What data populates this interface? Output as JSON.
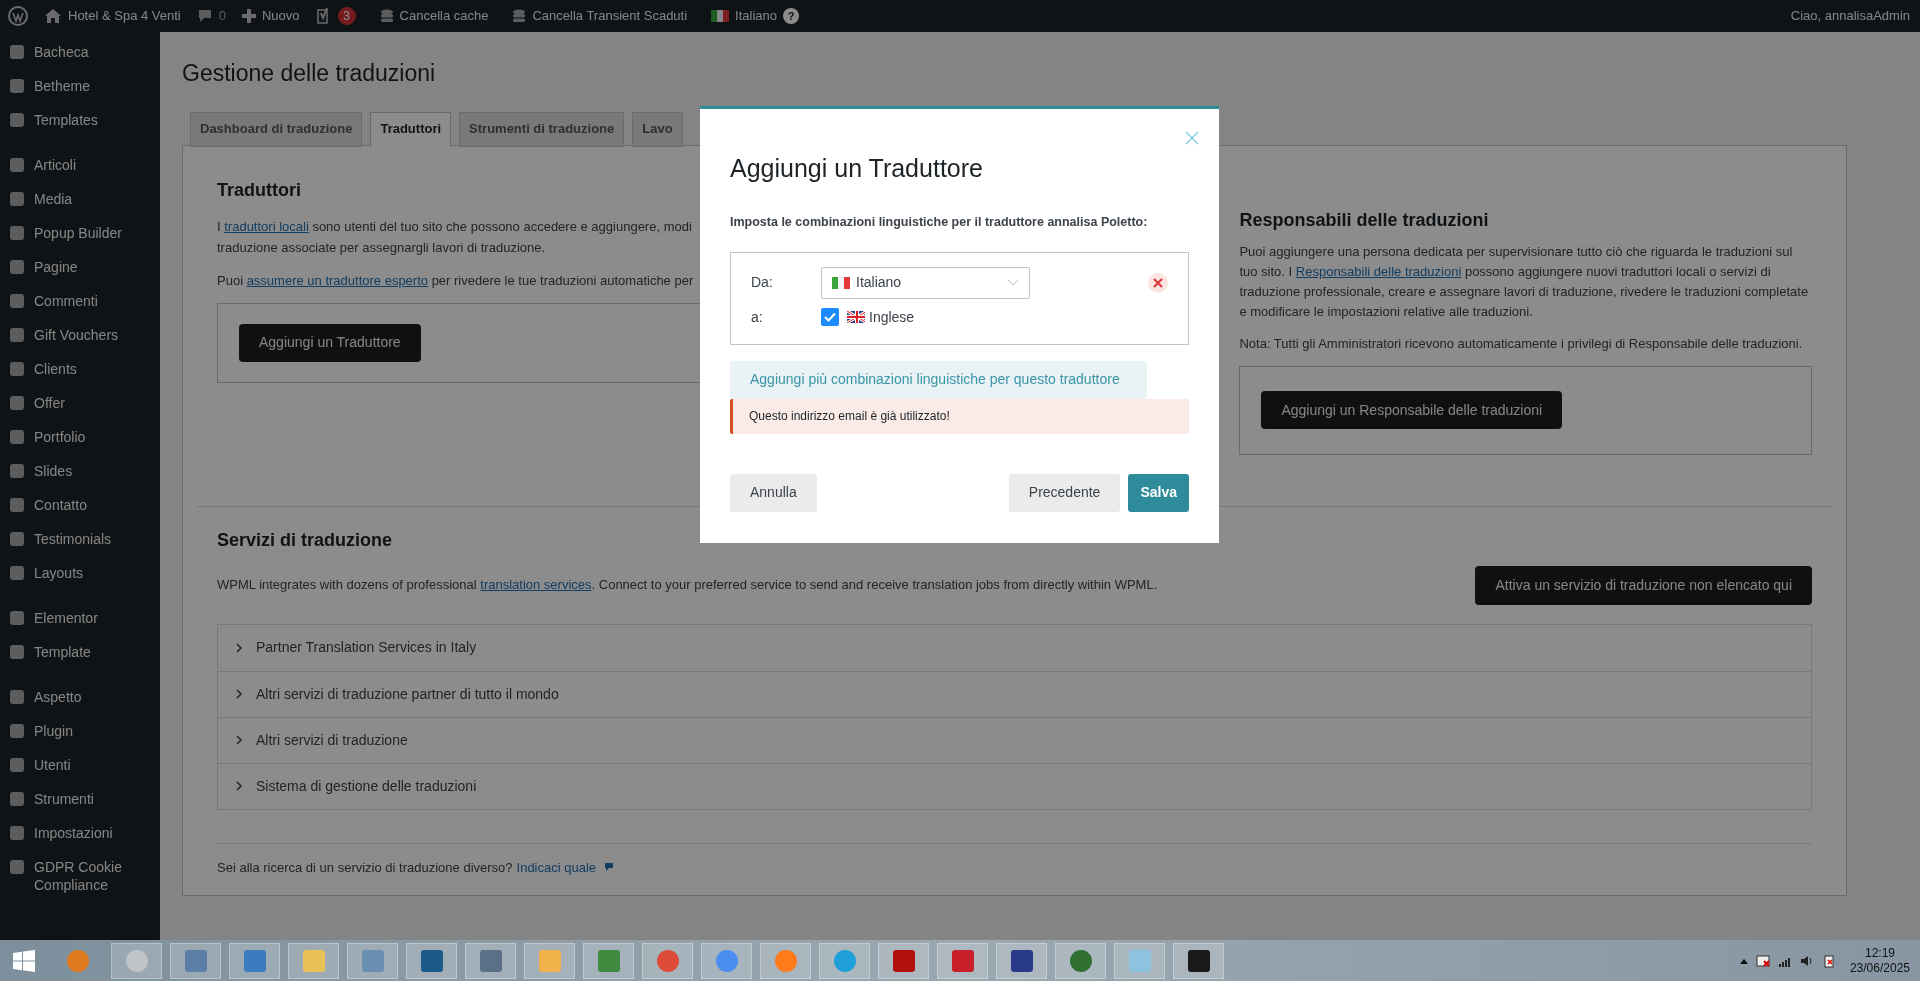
{
  "admin_bar": {
    "site": "Hotel & Spa 4 Venti",
    "comments": "0",
    "new": "Nuovo",
    "seo_badge": "3",
    "items": [
      "Cancella cache",
      "Cancella Transient Scaduti"
    ],
    "language": "Italiano",
    "help": "?",
    "greeting": "Ciao, annalisaAdmin"
  },
  "sidebar": {
    "groups": [
      [
        "Bacheca",
        "Betheme",
        "Templates"
      ],
      [
        "Articoli",
        "Media",
        "Popup Builder",
        "Pagine",
        "Commenti",
        "Gift Vouchers",
        "Clients",
        "Offer",
        "Portfolio",
        "Slides",
        "Contatto",
        "Testimonials",
        "Layouts"
      ],
      [
        "Elementor",
        "Template"
      ],
      [
        "Aspetto",
        "Plugin",
        "Utenti",
        "Strumenti",
        "Impostazioni",
        "GDPR Cookie Compliance"
      ]
    ]
  },
  "page_title": "Gestione delle traduzioni",
  "tabs": [
    {
      "label": "Dashboard di traduzione",
      "selected": false
    },
    {
      "label": "Traduttori",
      "selected": true
    },
    {
      "label": "Strumenti di traduzione",
      "selected": false
    },
    {
      "label": "Lavo",
      "selected": false
    }
  ],
  "translators": {
    "heading": "Traduttori",
    "lines": [
      [
        {
          "kind": "text",
          "text": "I "
        },
        {
          "kind": "link",
          "text": "traduttori locali"
        },
        {
          "kind": "text",
          "text": " sono utenti del tuo sito che possono accedere e aggiungere, modi"
        }
      ],
      [
        {
          "kind": "text",
          "text": "traduzione associate per assegnargli lavori di traduzione."
        }
      ],
      [
        {
          "kind": "text",
          "text": "Puoi "
        },
        {
          "kind": "link",
          "text": "assumere un traduttore esperto"
        },
        {
          "kind": "text",
          "text": " per rivedere le tue traduzioni automatiche per"
        }
      ]
    ],
    "button": "Aggiungi un Traduttore"
  },
  "managers": {
    "heading": "Responsabili delle traduzioni",
    "paragraph": [
      {
        "kind": "text",
        "text": "Puoi aggiungere una persona dedicata per supervisionare tutto ciò che riguarda le traduzioni sul tuo sito. I "
      },
      {
        "kind": "link",
        "text": "Responsabili delle traduzioni"
      },
      {
        "kind": "text",
        "text": " possono aggiungere nuovi traduttori locali o servizi di traduzione professionale, creare e assegnare lavori di traduzione, rivedere le traduzioni completate e modificare le impostazioni relative alle traduzioni."
      }
    ],
    "note": "Nota: Tutti gli Amministratori ricevono automaticamente i privilegi di Responsabile delle traduzioni.",
    "button": "Aggiungi un Responsabile delle traduzioni"
  },
  "services": {
    "heading": "Servizi di traduzione",
    "paragraph": [
      {
        "kind": "text",
        "text": "WPML integrates with dozens of professional "
      },
      {
        "kind": "link",
        "text": "translation services"
      },
      {
        "kind": "text",
        "text": ". Connect to your preferred service to send and receive translation jobs from directly within WPML."
      }
    ],
    "button": "Attiva un servizio di traduzione non elencato qui",
    "sections": [
      {
        "label": "Partner Translation Services in Italy",
        "expanded": false
      },
      {
        "label": "Altri servizi di traduzione partner di tutto il mondo",
        "expanded": false
      },
      {
        "label": "Altri servizi di traduzione",
        "expanded": false
      },
      {
        "label": "Sistema di gestione delle traduzioni",
        "expanded": false
      }
    ],
    "footer": "Sei alla ricerca di un servizio di traduzione diverso?",
    "footer_link": "Indicaci quale"
  },
  "modal": {
    "title": "Aggiungi un Traduttore",
    "subtitle": "Imposta le combinazioni linguistiche per il traduttore annalisa Poletto:",
    "from_label": "Da:",
    "from_value": "Italiano",
    "to_label": "a:",
    "targets": [
      {
        "label": "Inglese",
        "checked": true
      }
    ],
    "add_more": "Aggiungi più combinazioni linguistiche per questo traduttore",
    "error": "Questo indirizzo email è già utilizzato!",
    "cancel": "Annulla",
    "back": "Precedente",
    "save": "Salva"
  },
  "taskbar": {
    "time": "12:19",
    "date": "23/06/2025"
  }
}
